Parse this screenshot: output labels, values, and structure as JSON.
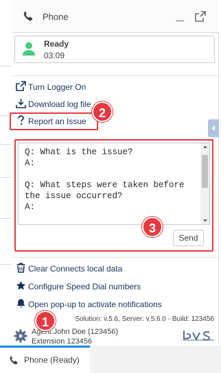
{
  "header": {
    "title": "Phone",
    "phone_icon": "phone-icon",
    "minimize_icon": "minimize-icon",
    "popout_icon": "popout-icon"
  },
  "status": {
    "state": "Ready",
    "timer": "03:09",
    "avatar_icon": "user-avatar-icon",
    "color": "#4bca81"
  },
  "links": [
    {
      "label": "Turn Logger On",
      "icon": "external-link-icon"
    },
    {
      "label": "Download log file",
      "icon": "download-icon"
    },
    {
      "label": "Report an Issue",
      "icon": "question-icon"
    }
  ],
  "issue_form": {
    "text": "Q: What is the issue?\nA:\n\nQ: What steps were taken before the issue occurred?\nA:\n\nQ: What was the expected result?",
    "send_label": "Send"
  },
  "actions": [
    {
      "label": "Clear Connects local data",
      "icon": "trash-icon"
    },
    {
      "label": "Configure Speed Dial numbers",
      "icon": "star-icon"
    },
    {
      "label": "Open pop-up to activate notifications",
      "icon": "bell-icon"
    }
  ],
  "footer": {
    "version": "Solution: v.5.6, Server: v.5.6.0 - Build: 123456",
    "agent_name": "Agent John Doe (123456)",
    "extension": "Extension 123456",
    "gear_icon": "gear-icon",
    "logo": "bvs-logo"
  },
  "annotations": {
    "badge1": "1",
    "badge2": "2",
    "badge3": "3",
    "color": "#e8393f"
  },
  "utility_bar": {
    "tab_label": "Phone (Ready)",
    "tab_icon": "phone-icon",
    "accent": "#1589ee"
  }
}
